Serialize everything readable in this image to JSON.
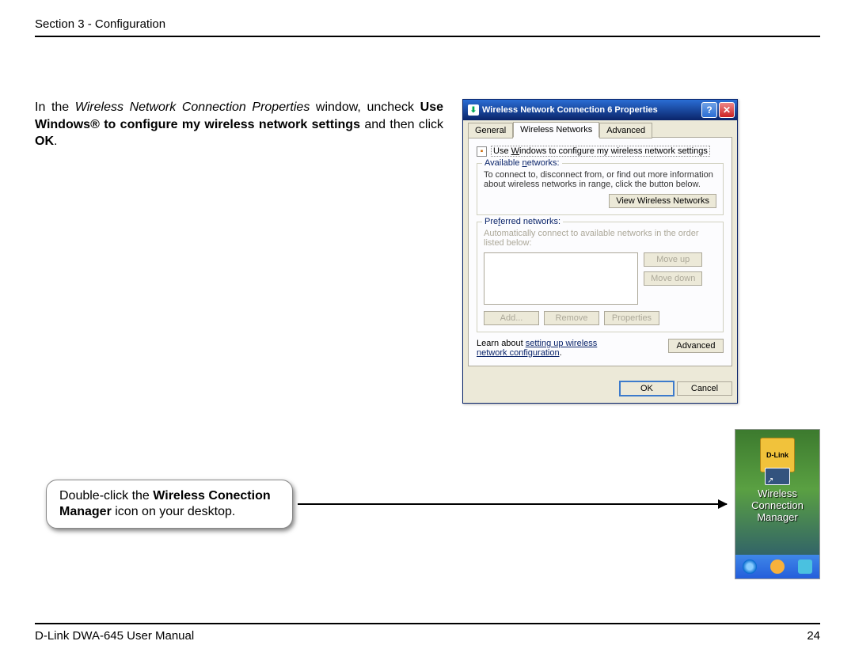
{
  "header": "Section 3 - Configuration",
  "instruction": {
    "p1a": "In the ",
    "p1b": "Wireless Network Connection Properties",
    "p1c": " window, uncheck ",
    "p1d": "Use Windows® to configure my wireless network settings",
    "p1e": " and then click ",
    "p1f": "OK",
    "p1g": "."
  },
  "dialog": {
    "title": "Wireless Network Connection 6 Properties",
    "tabs": {
      "general": "General",
      "wireless": "Wireless Networks",
      "advanced": "Advanced"
    },
    "checkbox": {
      "prefix": "U",
      "mid": "se ",
      "under": "W",
      "rest": "indows to configure my wireless network settings"
    },
    "group1": {
      "title_pre": "Available ",
      "title_u": "n",
      "title_post": "etworks:",
      "text": "To connect to, disconnect from, or find out more information about wireless networks in range, click the button below.",
      "button": "View Wireless Networks"
    },
    "group2": {
      "title_pre": "Pre",
      "title_u": "f",
      "title_post": "erred networks:",
      "text": "Automatically connect to available networks in the order listed below:",
      "moveup": "Move up",
      "movedown": "Move down",
      "add": "Add...",
      "remove": "Remove",
      "properties": "Properties"
    },
    "learn": {
      "pre": "Learn about ",
      "link": "setting up wireless network configuration",
      "post": ".",
      "adv": "Advanced"
    },
    "ok": "OK",
    "cancel": "Cancel"
  },
  "callout": {
    "p1": "Double-click the ",
    "p2": "Wireless Conection Manager",
    "p3": " icon on your desktop."
  },
  "desktop": {
    "brand": "D-Link",
    "label": "Wireless Connection Manager"
  },
  "footer": {
    "left": "D-Link DWA-645 User Manual",
    "page": "24"
  }
}
